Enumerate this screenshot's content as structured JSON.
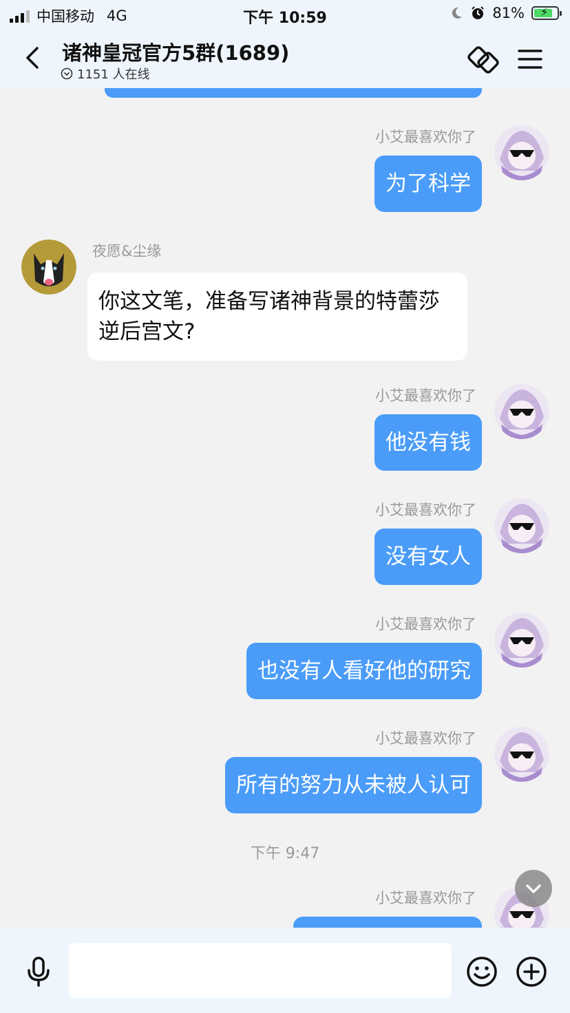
{
  "status_bar": {
    "carrier": "中国移动",
    "network": "4G",
    "time": "下午 10:59",
    "battery_percent": "81%",
    "battery_level": 0.81
  },
  "header": {
    "title": "诸神皇冠官方5群(1689)",
    "online": "1151 人在线"
  },
  "messages": [
    {
      "sender": "小艾最喜欢你了",
      "text": "为了科学",
      "self": true
    },
    {
      "sender": "夜愿&尘缘",
      "text": "你这文笔，准备写诸神背景的特蕾莎逆后宫文?",
      "self": false
    },
    {
      "sender": "小艾最喜欢你了",
      "text": "他没有钱",
      "self": true
    },
    {
      "sender": "小艾最喜欢你了",
      "text": "没有女人",
      "self": true
    },
    {
      "sender": "小艾最喜欢你了",
      "text": "也没有人看好他的研究",
      "self": true
    },
    {
      "sender": "小艾最喜欢你了",
      "text": "所有的努力从未被人认可",
      "self": true
    },
    {
      "sender": "小艾最喜欢你了",
      "text": "",
      "self": true
    }
  ],
  "time_divider": "下午 9:47",
  "input": {
    "placeholder": ""
  },
  "icons": {
    "back": "chevron-left-icon",
    "link": "link-icon",
    "menu": "menu-icon",
    "mic": "microphone-icon",
    "emoji": "smile-icon",
    "plus": "plus-icon",
    "scroll": "chevron-down-icon"
  },
  "colors": {
    "bubble_self": "#4a9cf8",
    "bubble_other": "#ffffff",
    "background": "#f2f2f2"
  }
}
